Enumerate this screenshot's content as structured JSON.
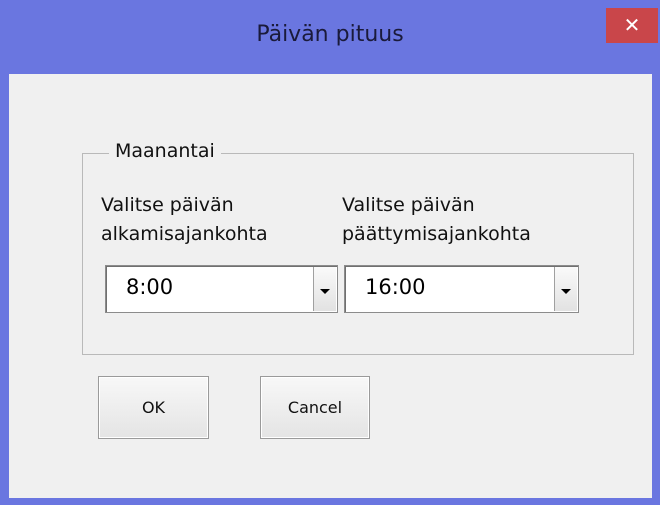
{
  "window": {
    "title": "Päivän pituus",
    "close_glyph": "✕"
  },
  "group": {
    "legend": "Maanantai",
    "start": {
      "label_line1": "Valitse päivän",
      "label_line2": "alkamisajankohta",
      "value": "8:00"
    },
    "end": {
      "label_line1": "Valitse päivän",
      "label_line2": "päättymisajankohta",
      "value": "16:00"
    }
  },
  "buttons": {
    "ok_label": "OK",
    "cancel_label": "Cancel"
  },
  "colors": {
    "titlebar": "#6a76e0",
    "close": "#c9464a",
    "client": "#f0f0f0"
  },
  "icons": {
    "close": "close-icon",
    "dropdown": "chevron-down-icon"
  }
}
